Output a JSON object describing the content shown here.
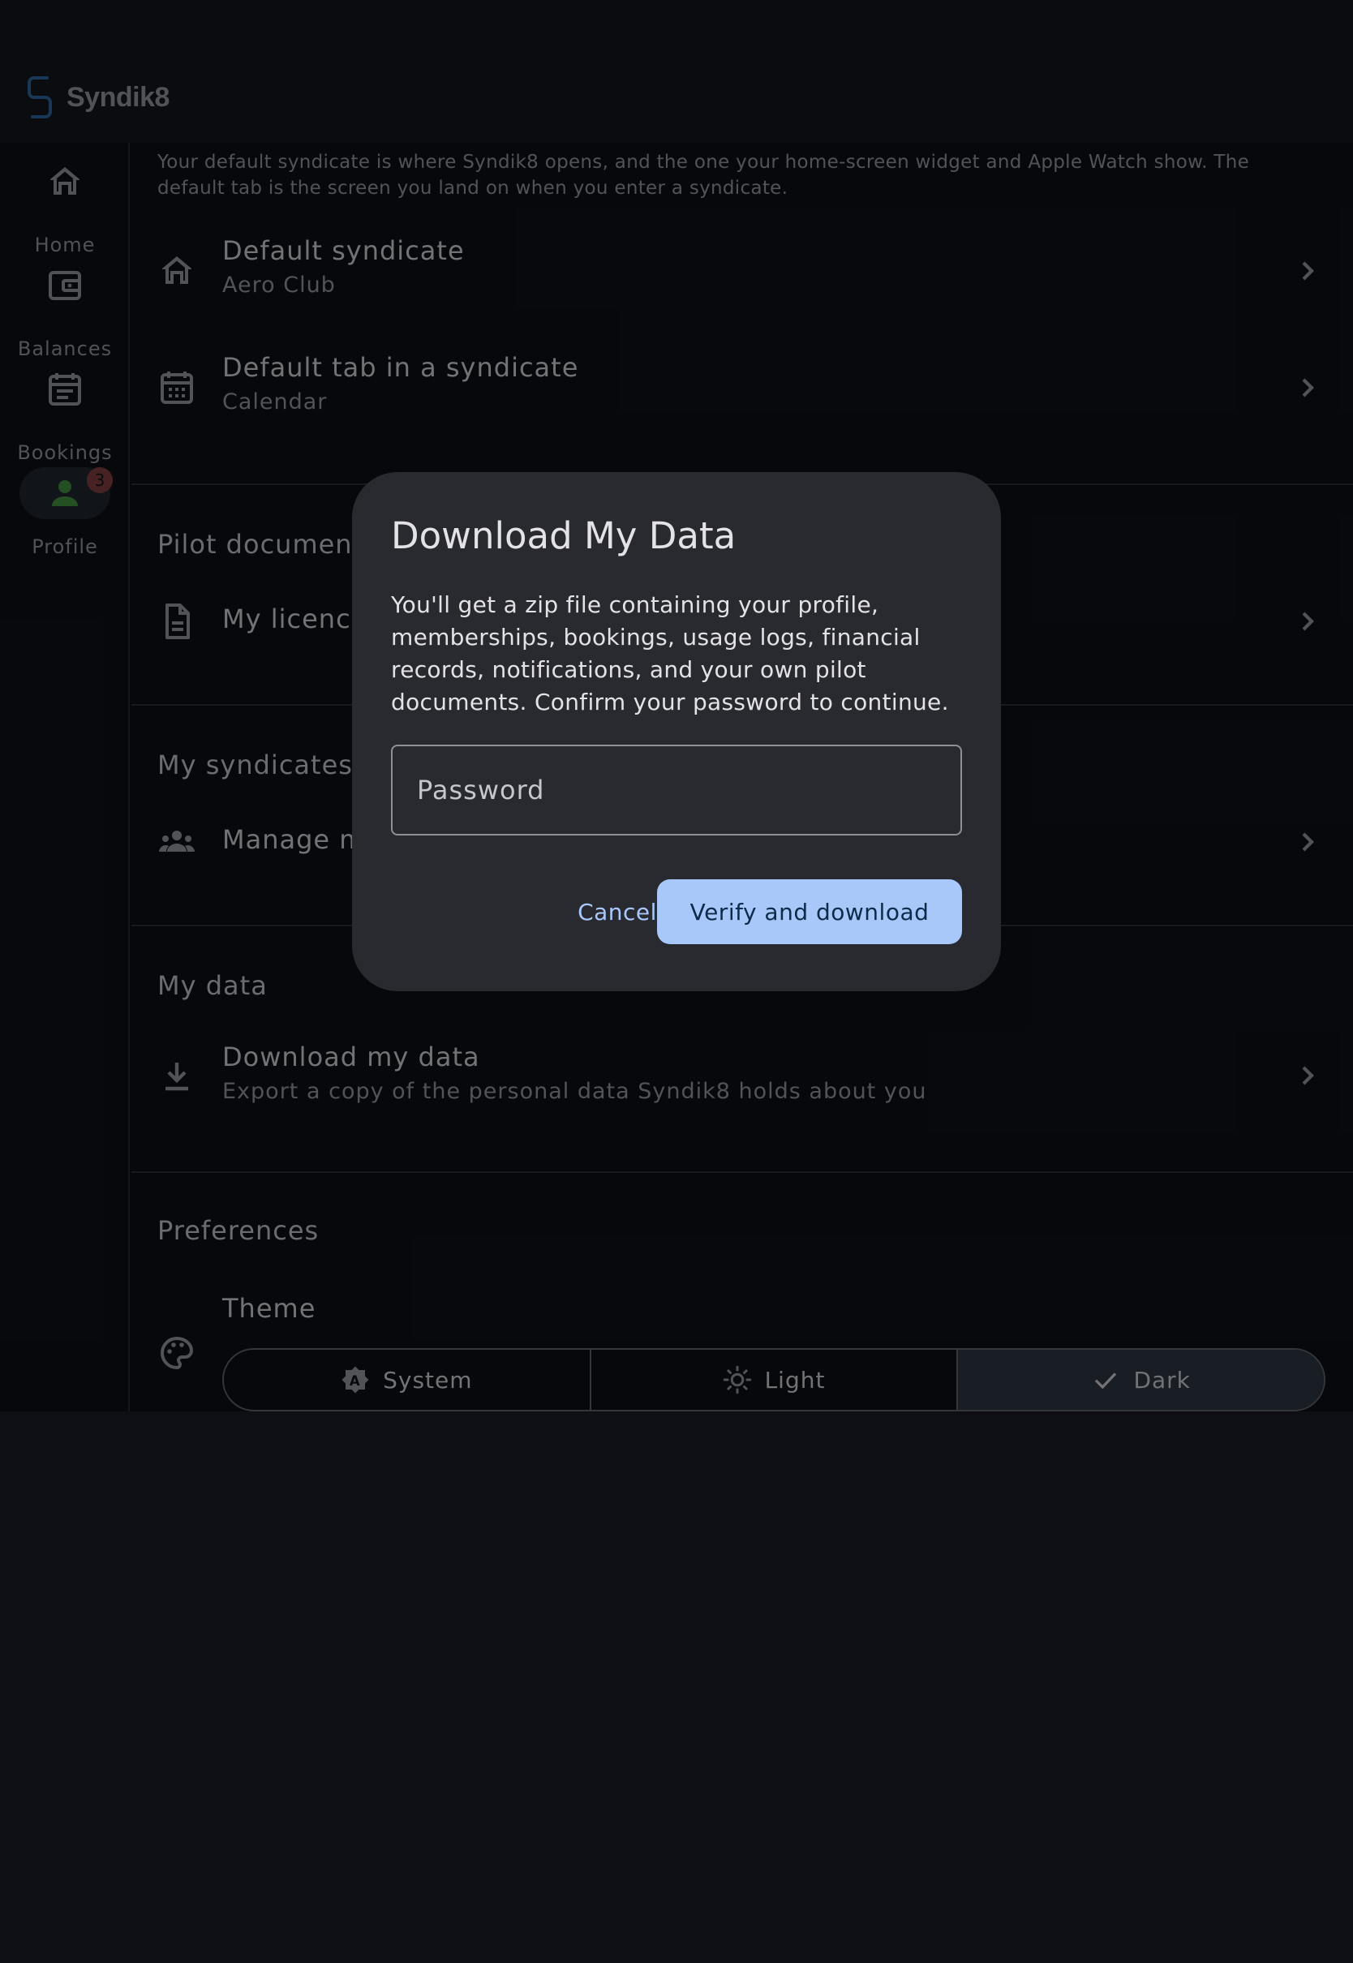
{
  "app": {
    "name": "Syndik8"
  },
  "nav": {
    "items": [
      {
        "label": "Home",
        "icon": "home-icon"
      },
      {
        "label": "Balances",
        "icon": "wallet-icon"
      },
      {
        "label": "Bookings",
        "icon": "bookings-icon"
      },
      {
        "label": "Profile",
        "icon": "person-icon",
        "badge": "3",
        "selected": true
      }
    ]
  },
  "settings": {
    "intro": "Your default syndicate is where Syndik8 opens, and the one your home-screen widget and Apple Watch show. The default tab is the screen you land on when you enter a syndicate.",
    "default_syndicate": {
      "title": "Default syndicate",
      "value": "Aero Club"
    },
    "default_tab": {
      "title": "Default tab in a syndicate",
      "value": "Calendar"
    },
    "pilot_documents": {
      "heading": "Pilot document",
      "row_title": "My licence"
    },
    "my_syndicates": {
      "heading": "My syndicates",
      "row_title": "Manage m"
    },
    "my_data": {
      "heading": "My data",
      "row_title": "Download my data",
      "row_subtitle": "Export a copy of the personal data Syndik8 holds about you"
    },
    "preferences": {
      "heading": "Preferences",
      "theme_label": "Theme",
      "options": [
        "System",
        "Light",
        "Dark"
      ],
      "selected": "Dark"
    }
  },
  "dialog": {
    "title": "Download My Data",
    "body": "You'll get a zip file containing your profile, memberships, bookings, usage logs, financial records, notifications, and your own pilot documents. Confirm your password to continue.",
    "password_placeholder": "Password",
    "password_value": "",
    "cancel_label": "Cancel",
    "confirm_label": "Verify and download"
  },
  "colors": {
    "background": "#0d0f14",
    "surface": "#292a30",
    "primary": "#a8c8fa",
    "on_primary": "#0f2b4a",
    "badge": "#7a3c3c",
    "profile_icon": "#3f8a3f"
  }
}
